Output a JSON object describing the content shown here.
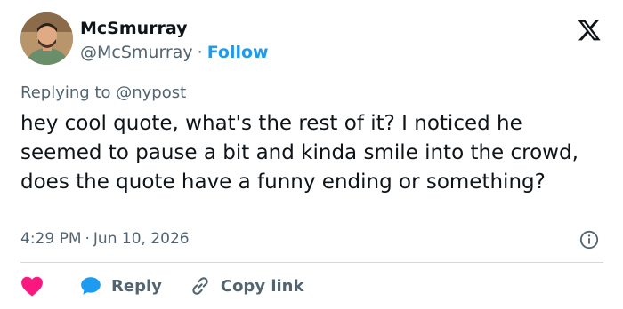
{
  "author": {
    "name": "McSmurray",
    "handle": "@McSmurray",
    "follow_label": "Follow",
    "separator": "·"
  },
  "reply_context": {
    "prefix": "Replying to",
    "target": "@nypost"
  },
  "tweet": {
    "text": "hey cool quote, what's the rest of it? I noticed he seemed to pause a bit and kinda smile into the crowd, does the quote have a funny ending or something?",
    "time": "4:29 PM",
    "separator": "·",
    "date": "Jun 10, 2026"
  },
  "actions": {
    "reply_label": "Reply",
    "copy_link_label": "Copy link"
  },
  "colors": {
    "accent": "#1d9bf0",
    "heart": "#f91880",
    "muted": "#536471",
    "text": "#0f1419"
  },
  "icons": [
    "x-logo-icon",
    "info-icon",
    "heart-icon",
    "reply-icon",
    "link-icon"
  ]
}
